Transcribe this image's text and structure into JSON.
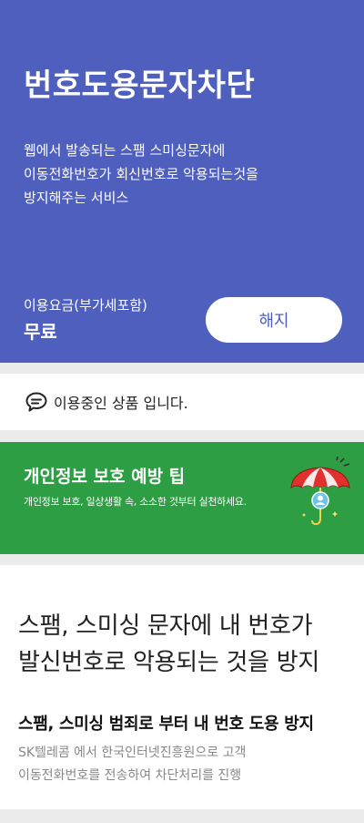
{
  "hero": {
    "title": "번호도용문자차단",
    "description": [
      "웹에서 발송되는 스팸 스미싱문자에",
      "이동전화번호가 회신번호로 악용되는것을",
      "방지해주는 서비스"
    ],
    "fee_label": "이용요금(부가세포함)",
    "fee_value": "무료",
    "cancel_label": "해지"
  },
  "status": {
    "icon": "chat-bubble-icon",
    "text": "이용중인 상품 입니다."
  },
  "tip": {
    "title": "개인정보 보호 예방 팁",
    "subtitle": "개인정보 보호, 일상생활 속, 소소한 것부터 실천하세요.",
    "icon": "umbrella-icon"
  },
  "info": {
    "headline": [
      "스팸, 스미싱 문자에 내 번호가",
      "발신번호로 악용되는 것을 방지"
    ],
    "subhead": "스팸, 스미싱 범죄로 부터 내 번호 도용 방지",
    "body": [
      "SK텔레콤 에서 한국인터넷진흥원으로 고객",
      "이동전화번호를 전송하여 차단처리를 진행"
    ]
  },
  "colors": {
    "hero_bg": "#4f5fbd",
    "tip_bg": "#2e9e45",
    "page_bg": "#ececec"
  }
}
